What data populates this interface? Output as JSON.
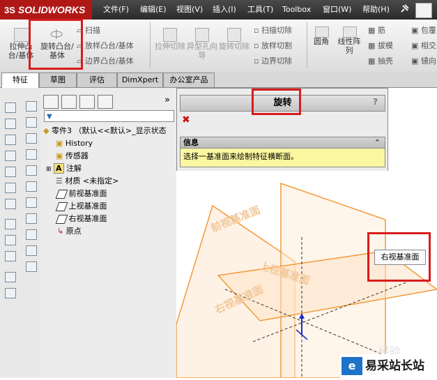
{
  "app": {
    "logo_text": "SOLIDWORKS",
    "logo_prefix": "3S"
  },
  "menu": [
    "文件(F)",
    "编辑(E)",
    "视图(V)",
    "插入(I)",
    "工具(T)",
    "Toolbox",
    "窗口(W)",
    "帮助(H)"
  ],
  "ribbon": {
    "extrude_boss": "拉伸凸台/基体",
    "revolve_boss": "旋转凸台/基体",
    "sweep": "扫描",
    "loft": "放样凸台/基体",
    "boundary": "边界凸台/基体",
    "extrude_cut": "拉伸切除",
    "hole_wizard": "异型孔向导",
    "revolve_cut": "旋转切除",
    "swept_cut": "扫描切除",
    "lofted_cut": "放样切割",
    "boundary_cut": "边界切除",
    "fillet": "圆角",
    "linear_pattern": "线性阵列",
    "rib": "筋",
    "draft": "拔模",
    "shell": "抽壳",
    "wrap": "包覆",
    "intersect": "相交",
    "mirror": "镜向"
  },
  "tabs": [
    "特征",
    "草图",
    "评估",
    "DimXpert",
    "办公室产品"
  ],
  "tree": {
    "expand": "»",
    "root": "零件3 （默认<<默认>_显示状态",
    "items": [
      "History",
      "传感器",
      "注解",
      "材质 <未指定>",
      "前视基准面",
      "上视基准面",
      "右视基准面",
      "原点"
    ]
  },
  "property_manager": {
    "title": "旋转",
    "help": "?",
    "cancel": "✖",
    "info_header": "信息",
    "info_toggle": "⌃",
    "info_text": "选择一基准面来绘制特征横断面。"
  },
  "viewport": {
    "planes": [
      "前视基准面",
      "上视基准面",
      "右视基准面"
    ],
    "tooltip": "右视基准面"
  },
  "watermark": {
    "logo": "e",
    "text": "易采站长站",
    "faint": "经验"
  },
  "colors": {
    "accent_red": "#d81c1c",
    "plane_orange": "#f29a3a",
    "info_yellow": "#fbf7a0"
  }
}
